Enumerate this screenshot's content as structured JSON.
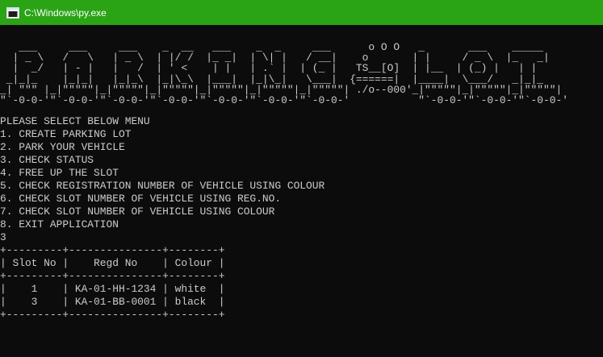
{
  "window": {
    "title": "C:\\Windows\\py.exe",
    "icon": "console-window-icon",
    "titlebar_color": "#2aa415"
  },
  "console": {
    "text_color": "#cccccc",
    "background": "#0c0c0c",
    "banner": [
      "   ___     ___     ___    _  __   ___    _  _     ___      o O O   _       ___    _____",
      "  | _ \\   /   \\   | _ \\  | |/ /  |_ _|  | \\| |   / __|    o       | |     / _ \\  |_   _|",
      "  |  _/   | - |   |   /  | ' <    | |   | .` |  | (_ |   TS__[O]  | |__  | (_) |   | |",
      " _|_|_    |_|_|   |_|_\\  |_|\\_\\  |___|  |_|\\_|   \\___|  {======|  |____|  \\___/   _|_|_",
      "_| \"\"\" |_|\"\"\"\"\"|_|\"\"\"\"\"|_|\"\"\"\"\"|_|\"\"\"\"\"|_|\"\"\"\"\"|_|\"\"\"\"\"| ./o--000'_|\"\"\"\"\"|_|\"\"\"\"\"|_|\"\"\"\"\"|",
      "\"`-0-0-'\"`-0-0-'\"`-0-0-'\"`-0-0-'\"`-0-0-'\"`-0-0-'\"`-0-0-'           \"`-0-0-'\"`-0-0-'\"`-0-0-'"
    ],
    "menu_lines": [
      "PLEASE SELECT BELOW MENU",
      "1. CREATE PARKING LOT",
      "2. PARK YOUR VEHICLE",
      "3. CHECK STATUS",
      "4. FREE UP THE SLOT",
      "5. CHECK REGISTRATION NUMBER OF VEHICLE USING COLOUR",
      "6. CHECK SLOT NUMBER OF VEHICLE USING REG.NO.",
      "7. CHECK SLOT NUMBER OF VEHICLE USING COLOUR",
      "8. EXIT APPLICATION",
      "3"
    ],
    "table": {
      "border": "+---------+---------------+--------+",
      "header": "| Slot No |    Regd No    | Colour |",
      "rows": [
        "|    1    | KA-01-HH-1234 | white  |",
        "|    3    | KA-01-BB-0001 | black  |"
      ]
    }
  }
}
